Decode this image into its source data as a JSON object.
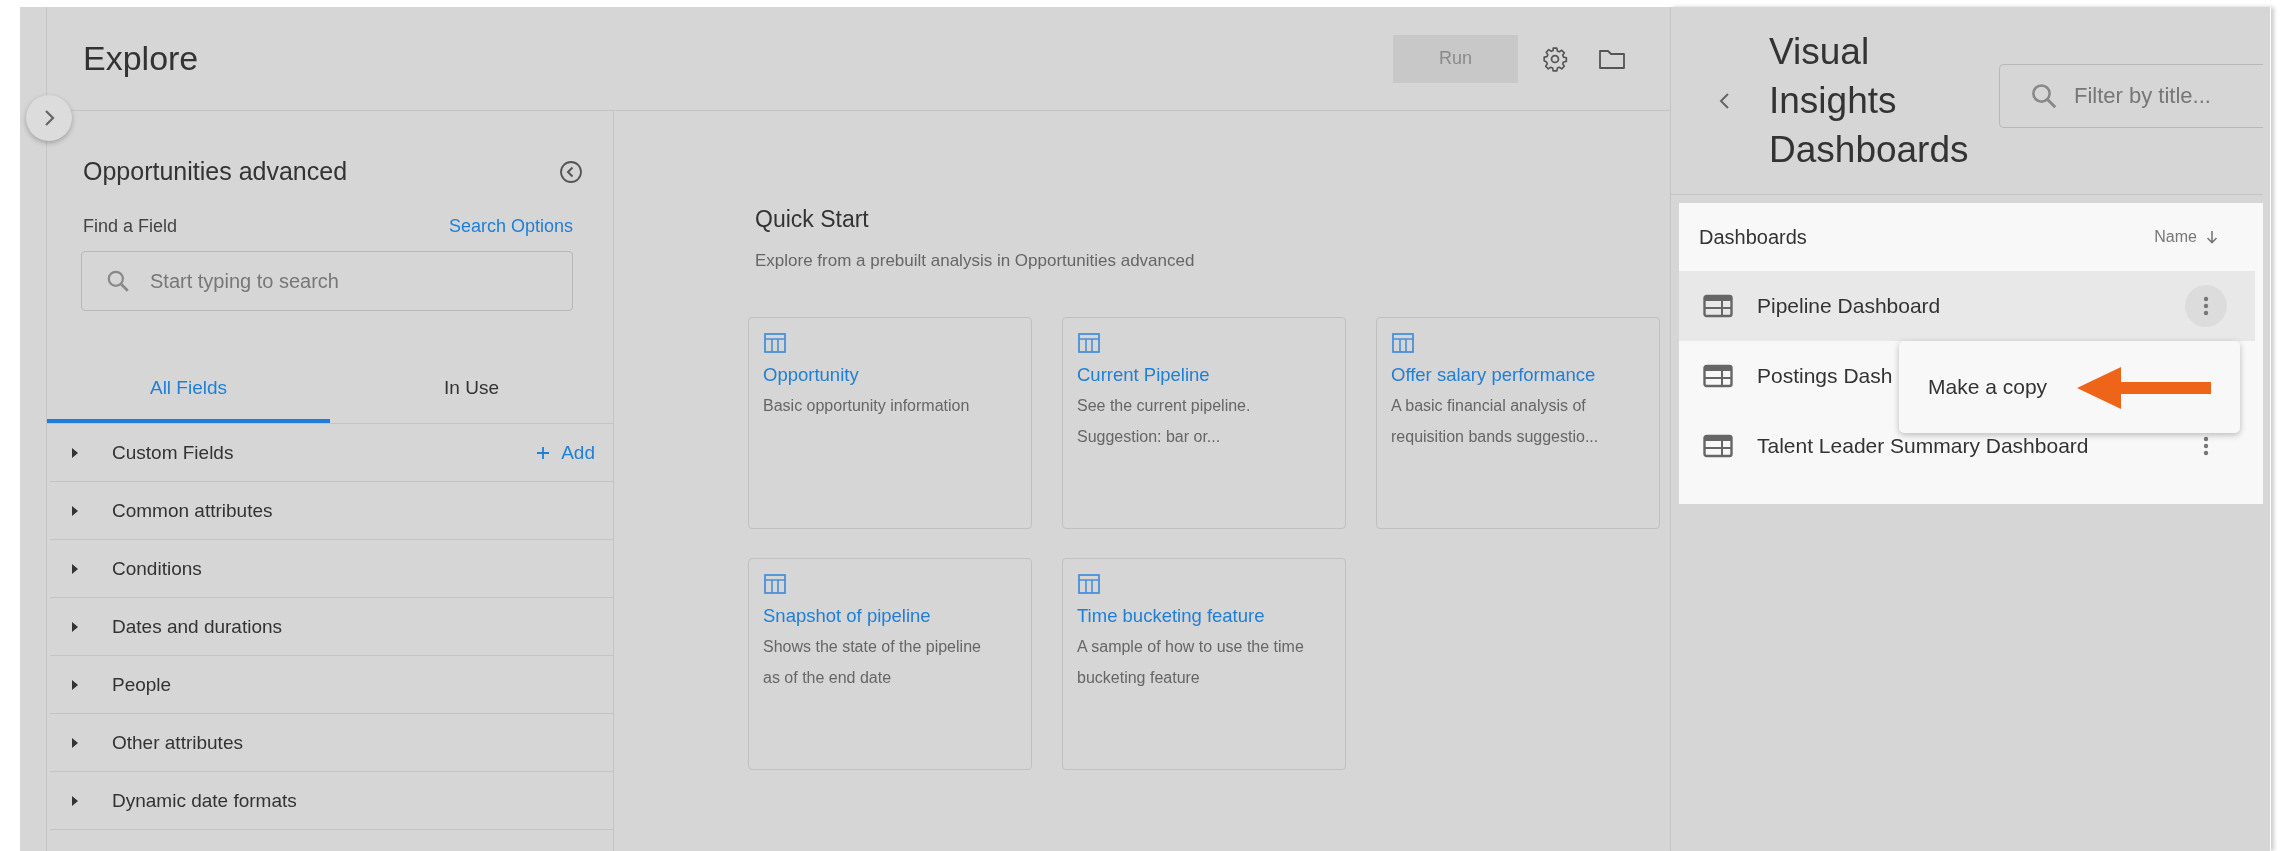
{
  "header": {
    "title": "Explore",
    "run_button": "Run"
  },
  "field_panel": {
    "title": "Opportunities advanced",
    "find_label": "Find a Field",
    "search_options": "Search Options",
    "search": {
      "placeholder": "Start typing to search"
    },
    "tabs": [
      {
        "label": "All Fields",
        "selected": true
      },
      {
        "label": "In Use",
        "selected": false
      }
    ],
    "groups": [
      {
        "label": "Custom Fields",
        "action": "Add"
      },
      {
        "label": "Common attributes"
      },
      {
        "label": "Conditions"
      },
      {
        "label": "Dates and durations"
      },
      {
        "label": "People"
      },
      {
        "label": "Other attributes"
      },
      {
        "label": "Dynamic date formats"
      }
    ]
  },
  "quick_start": {
    "title": "Quick Start",
    "subtitle": "Explore from a prebuilt analysis in Opportunities advanced",
    "cards": [
      {
        "title": "Opportunity",
        "description": "Basic opportunity information"
      },
      {
        "title": "Current Pipeline",
        "description": "See the current pipeline. Suggestion: bar or..."
      },
      {
        "title": "Offer salary performance",
        "description": "A basic financial analysis of requisition bands suggestio..."
      },
      {
        "title": "Snapshot of pipeline",
        "description": "Shows the state of the pipeline as of the end date"
      },
      {
        "title": "Time bucketing feature",
        "description": "A sample of how to use the time bucketing feature"
      }
    ]
  },
  "dashboards_panel": {
    "title": "Visual Insights Dashboards",
    "filter": {
      "placeholder": "Filter by title..."
    },
    "list_title": "Dashboards",
    "sort_label": "Name",
    "rows": [
      {
        "name": "Pipeline Dashboard",
        "selected": true,
        "more_button": true
      },
      {
        "name": "Postings Dash",
        "selected": false
      },
      {
        "name": "Talent Leader Summary Dashboard",
        "selected": false,
        "more_button": true
      }
    ],
    "menu": {
      "items": [
        "Make a copy"
      ]
    }
  }
}
